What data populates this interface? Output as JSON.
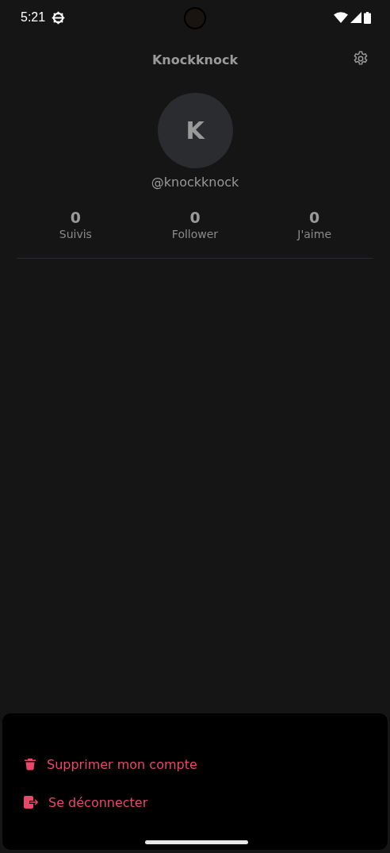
{
  "status_bar": {
    "time": "5:21"
  },
  "header": {
    "title": "Knockknock"
  },
  "profile": {
    "avatar_initial": "K",
    "handle": "@knockknock"
  },
  "stats": [
    {
      "value": "0",
      "label": "Suivis"
    },
    {
      "value": "0",
      "label": "Follower"
    },
    {
      "value": "0",
      "label": "J'aime"
    }
  ],
  "sheet": {
    "actions": [
      {
        "kind": "delete",
        "label": "Supprimer mon compte"
      },
      {
        "kind": "logout",
        "label": "Se déconnecter"
      }
    ]
  }
}
